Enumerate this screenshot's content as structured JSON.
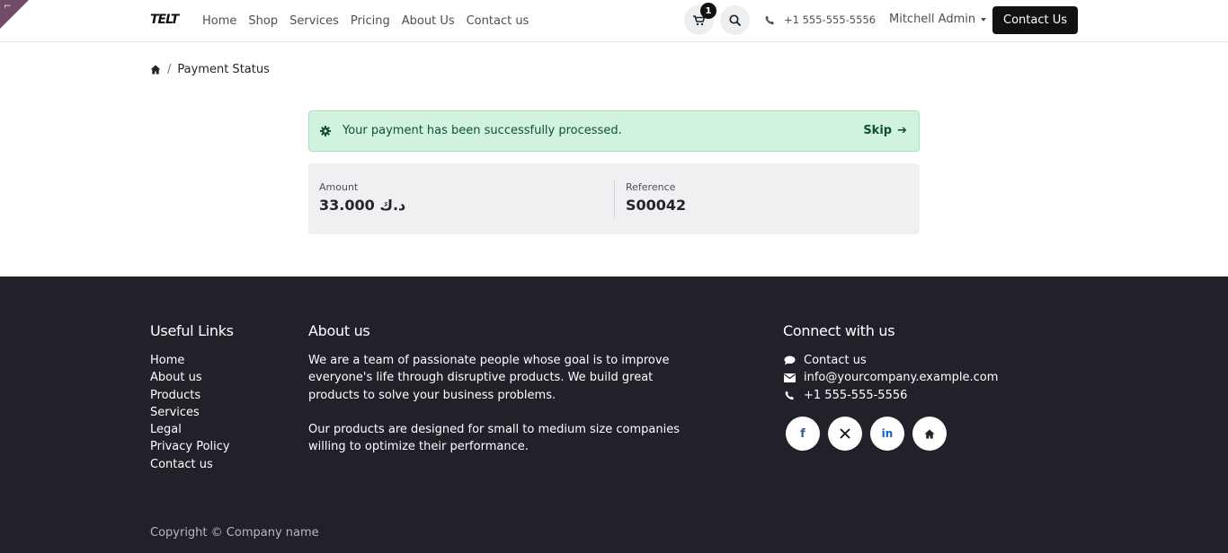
{
  "header": {
    "logo": "TELT",
    "nav": [
      "Home",
      "Shop",
      "Services",
      "Pricing",
      "About Us",
      "Contact us"
    ],
    "cart_count": "1",
    "phone": "+1 555-555-5556",
    "user": "Mitchell Admin",
    "contact_button": "Contact Us"
  },
  "breadcrumb": {
    "current": "Payment Status"
  },
  "alert": {
    "message": "Your payment has been successfully processed.",
    "skip": "Skip"
  },
  "summary": {
    "amount_label": "Amount",
    "amount_value": "33.000 د.ك",
    "reference_label": "Reference",
    "reference_value": "S00042"
  },
  "footer": {
    "useful_links_title": "Useful Links",
    "useful_links": [
      "Home",
      "About us",
      "Products",
      "Services",
      "Legal",
      "Privacy Policy",
      "Contact us"
    ],
    "about_title": "About us",
    "about_p1": "We are a team of passionate people whose goal is to improve everyone's life through disruptive products. We build great products to solve your business problems.",
    "about_p2": "Our products are designed for small to medium size companies willing to optimize their performance.",
    "connect_title": "Connect with us",
    "connect_contact": "Contact us",
    "connect_email": "info@yourcompany.example.com",
    "connect_phone": "+1 555-555-5556",
    "copyright": "Copyright © Company name"
  },
  "colors": {
    "brand": "#714b67",
    "alert_bg": "#d1f2df",
    "alert_text": "#0f5132",
    "footer_bg": "#212229"
  }
}
